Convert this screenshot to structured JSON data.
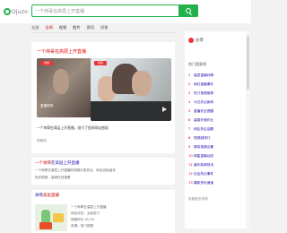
{
  "logo": {
    "text": "Ojuzo"
  },
  "search": {
    "query": "一个帅哥在高层上开直播"
  },
  "tabs": [
    {
      "label": "全部",
      "active": false
    },
    {
      "label": "全网",
      "active": true
    },
    {
      "label": "视频",
      "active": false
    },
    {
      "label": "图片",
      "active": false
    },
    {
      "label": "资讯",
      "active": false
    },
    {
      "label": "问答",
      "active": false
    }
  ],
  "video_card": {
    "title_prefix": "一个帅哥在",
    "title_highlight": "高层上开直播",
    "videos": [
      {
        "badge": "视频",
        "caption": "直播现场"
      },
      {
        "badge": "视频"
      }
    ],
    "caption": "一个帅哥在高层上开直播，吸引了很多网友围观",
    "source": "视频网"
  },
  "result2": {
    "title_prefix": "一个帅哥",
    "title_highlight": "在高层上开直播",
    "desc1": "一个帅哥在高层上开直播的视频引发热议，网友纷纷留言",
    "desc2": "相关视频 - 高清在线观看"
  },
  "result3": {
    "title_prefix": "帅哥",
    "title_highlight": "高层直播",
    "lines": [
      "一个帅哥在高层上开直播",
      "网友评论：太危险了",
      "视频时长 01:25",
      "来源：热门视频"
    ]
  },
  "sidebar": {
    "share_label": "分享",
    "heading": "热门搜索榜",
    "items": [
      "高层直播帅哥",
      "网红直播事件",
      "热门视频推荐",
      "今日热点新闻",
      "直播安全提醒",
      "高楼外墙作业",
      "网友热议话题",
      "短视频排行",
      "搞笑视频合集",
      "明星直播动态",
      "娱乐新闻快讯",
      "社会热点事件",
      "最新资讯速递"
    ],
    "footer": "查看更多热搜"
  },
  "colors": {
    "brand": "#22b14c",
    "highlight": "#cc0000",
    "link": "#1a0dab"
  }
}
